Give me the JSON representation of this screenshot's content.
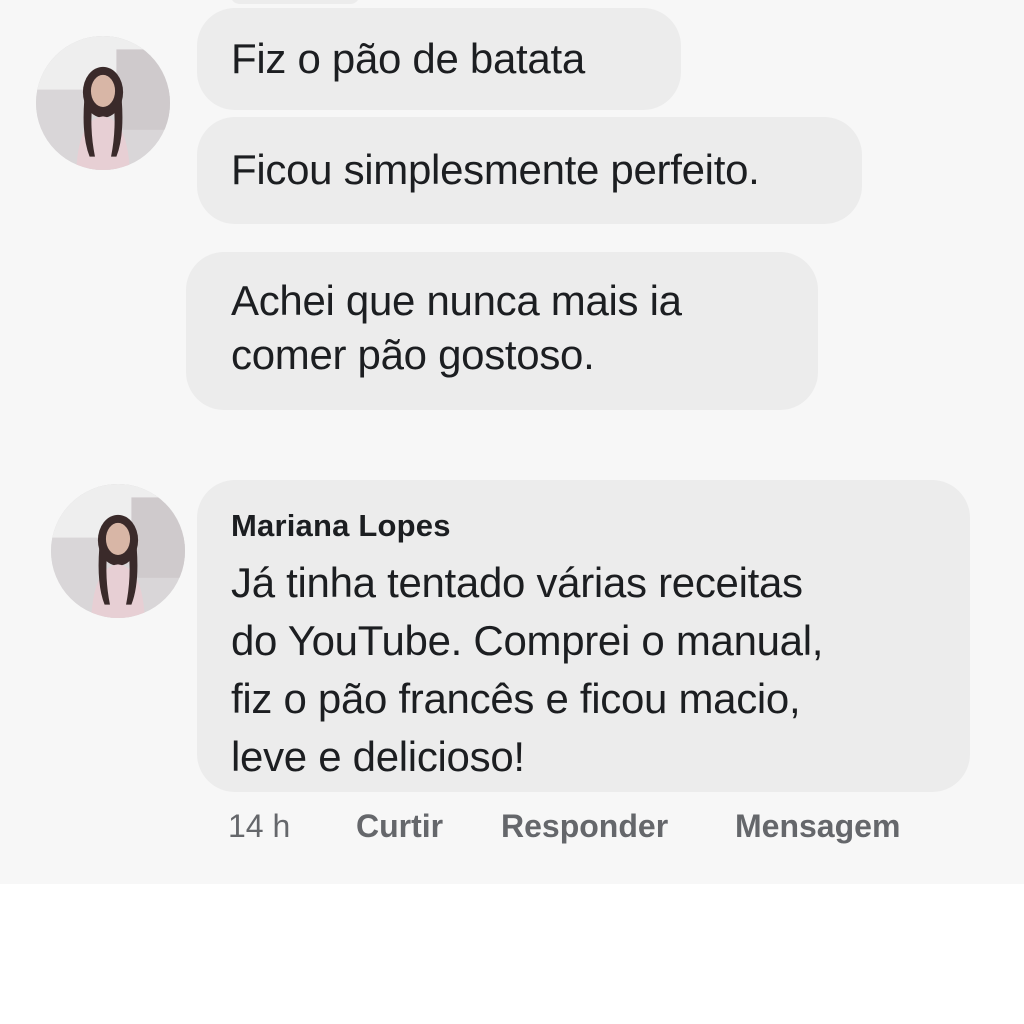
{
  "comments": [
    {
      "bubbles": [
        "Fiz o pão de batata",
        "Ficou simplesmente perfeito."
      ]
    },
    {
      "bubbles": [
        "Achei que nunca mais ia\ncomer pão gostoso."
      ]
    },
    {
      "author": "Mariana Lopes",
      "text": "Já tinha tentado várias receitas\ndo YouTube. Comprei o manual,\nfiz o pão francês e ficou macio,\nleve e delicioso!",
      "time": "14 h",
      "actions": {
        "like": "Curtir",
        "reply": "Responder",
        "message": "Mensagem"
      }
    }
  ],
  "colors": {
    "background": "#f7f7f7",
    "bubble": "#ececec",
    "text": "#1c1e21",
    "meta": "#65676b"
  },
  "icons": [
    "avatar-photo"
  ]
}
